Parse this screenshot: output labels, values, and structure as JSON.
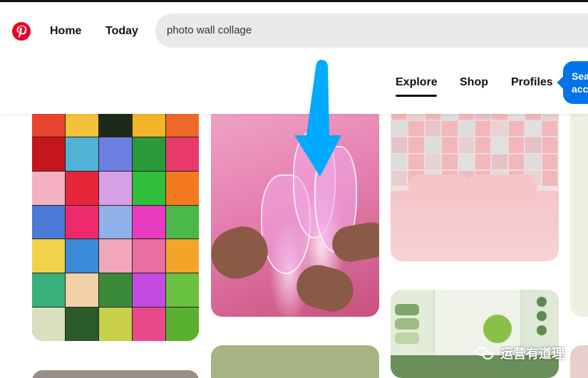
{
  "header": {
    "home_label": "Home",
    "today_label": "Today"
  },
  "search": {
    "value": "photo wall collage"
  },
  "tabs": [
    {
      "label": "Explore",
      "active": true
    },
    {
      "label": "Shop",
      "active": false
    },
    {
      "label": "Profiles",
      "active": false
    }
  ],
  "tooltip": {
    "line1": "Sea",
    "line2": "acc"
  },
  "watermark": {
    "text": "运营有道理"
  },
  "colors": {
    "brand": "#e60023",
    "tooltip": "#0074e8",
    "arrow": "#00aaff"
  },
  "icons": {
    "logo": "pinterest-logo-icon",
    "arrow": "arrow-down-icon",
    "watermark": "wechat-icon"
  }
}
